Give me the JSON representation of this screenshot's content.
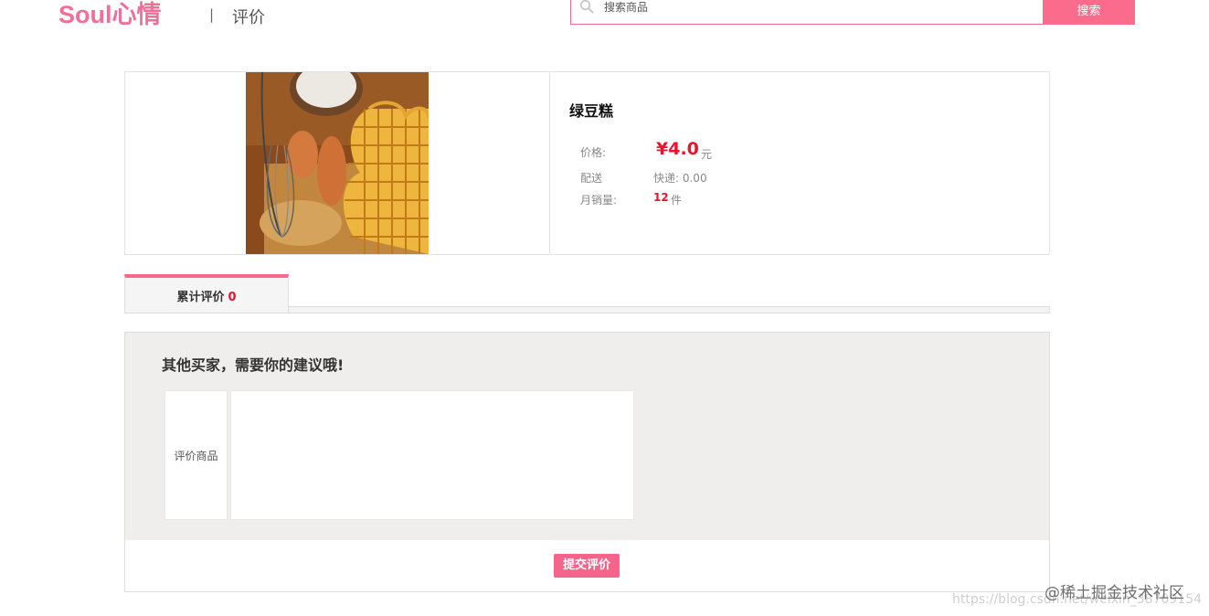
{
  "header": {
    "logo": "Soul心情",
    "separator": "|",
    "page_title": "评价"
  },
  "search": {
    "placeholder": "搜索商品",
    "button_label": "搜索",
    "accent": "#fa6b8c"
  },
  "product": {
    "name": "绿豆糕",
    "price_label": "价格:",
    "price_value": "¥4.0",
    "price_unit": "元",
    "shipping_label": "配送",
    "shipping_value": "快递: 0.00",
    "sales_label": "月销量:",
    "sales_value": "12",
    "sales_unit": "件",
    "price_color": "#e8142b"
  },
  "tabs": [
    {
      "label": "累计评价",
      "count": "0",
      "active": true
    }
  ],
  "review": {
    "heading": "其他买家，需要你的建议哦!",
    "item_label": "评价商品",
    "textarea_value": "",
    "submit_label": "提交评价"
  },
  "watermark": {
    "brand": "@稀土掘金技术社区",
    "url": "https://blog.csdn.net/weixin_38709154"
  }
}
